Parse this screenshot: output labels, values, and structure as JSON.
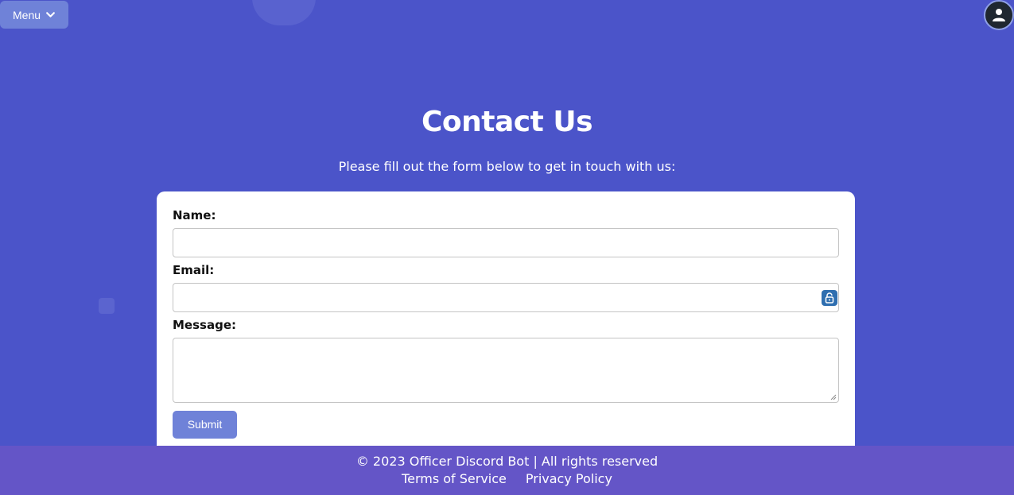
{
  "header": {
    "menu_label": "Menu"
  },
  "main": {
    "title": "Contact Us",
    "subtitle": "Please fill out the form below to get in touch with us:"
  },
  "form": {
    "name_label": "Name:",
    "name_value": "",
    "email_label": "Email:",
    "email_value": "",
    "message_label": "Message:",
    "message_value": "",
    "submit_label": "Submit"
  },
  "footer": {
    "copyright": "© 2023 Officer Discord Bot | All rights reserved",
    "terms_label": "Terms of Service",
    "privacy_label": "Privacy Policy"
  },
  "colors": {
    "background": "#4b54c9",
    "accent_button": "#6f82d8",
    "footer": "#6455c7"
  },
  "icons": [
    "chevron-down-icon",
    "user-avatar-icon",
    "password-manager-lock-icon"
  ]
}
